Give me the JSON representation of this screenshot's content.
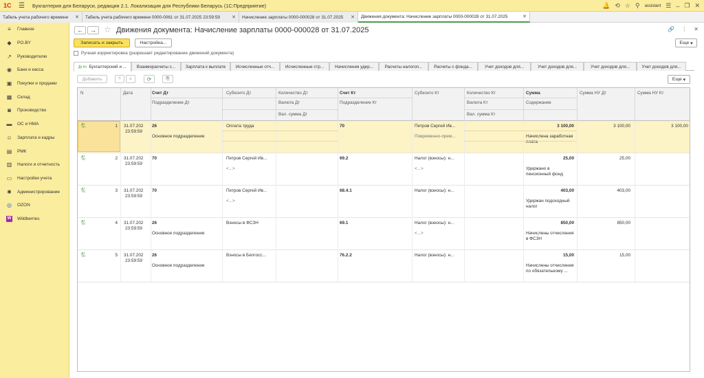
{
  "app": {
    "title": "Бухгалтерия для Беларуси, редакция 2.1. Локализация для Республики Беларусь   (1С:Предприятие)",
    "logo": "1С",
    "user": "assistant"
  },
  "open_tabs": [
    {
      "label": "Табель учета рабочего времени"
    },
    {
      "label": "Табель учета рабочего времени 0000-0061 от 31.07.2025 23:59:59"
    },
    {
      "label": "Начисление зарплаты 0000-000028 от 31.07.2025"
    },
    {
      "label": "Движения документа: Начисление зарплаты 0000-000028 от 31.07.2025"
    }
  ],
  "sidebar": [
    {
      "label": "Главное",
      "icon": "menu-icon"
    },
    {
      "label": "PO.BY",
      "icon": "tag-icon"
    },
    {
      "label": "Руководителю",
      "icon": "trend-icon"
    },
    {
      "label": "Банк и касса",
      "icon": "coin-icon"
    },
    {
      "label": "Покупки и продажи",
      "icon": "cart-icon"
    },
    {
      "label": "Склад",
      "icon": "warehouse-icon"
    },
    {
      "label": "Производство",
      "icon": "factory-icon"
    },
    {
      "label": "ОС и НМА",
      "icon": "truck-icon"
    },
    {
      "label": "Зарплата и кадры",
      "icon": "people-icon"
    },
    {
      "label": "РМК",
      "icon": "register-icon"
    },
    {
      "label": "Налоги и отчетность",
      "icon": "chart-icon"
    },
    {
      "label": "Настройки учета",
      "icon": "doc-icon"
    },
    {
      "label": "Администрирование",
      "icon": "gear-icon"
    },
    {
      "label": "OZON",
      "icon": "ozon-icon"
    },
    {
      "label": "Wildberries",
      "icon": "wb-icon"
    }
  ],
  "doc": {
    "title": "Движения документа: Начисление зарплаты 0000-000028 от 31.07.2025"
  },
  "toolbar": {
    "save_close": "Записать и закрыть",
    "settings": "Настройка...",
    "more": "Еще",
    "add": "Добавить"
  },
  "manual_correction": "Ручная корректировка (разрешает редактирование движений документа)",
  "register_tabs": [
    "Бухгалтерский и ...",
    "Взаиморасчеты с...",
    "Зарплата к выплате",
    "Исчисленные отч...",
    "Исчисленные стр...",
    "Начисления удер...",
    "Расчеты налогоп...",
    "Расчеты с фонда...",
    "Учет доходов для...",
    "Учет доходов для...",
    "Учет доходов для...",
    "Учет доходов для..."
  ],
  "headers": {
    "n": "N",
    "date": "Дата",
    "schet_dt": "Счет Дт",
    "podr_dt": "Подразделение Дт",
    "subkonto_dt": "Субконто Дт",
    "kol_dt": "Количество Дт",
    "valuta_dt": "Валюта Дт",
    "val_sum_dt": "Вал. сумма Дт",
    "schet_kt": "Счет Кт",
    "podr_kt": "Подразделение Кт",
    "subkonto_kt": "Субконто Кт",
    "kol_kt": "Количество Кт",
    "valuta_kt": "Валюта Кт",
    "val_sum_kt": "Вал. сумма Кт",
    "summa": "Сумма",
    "soderzhanie": "Содержание",
    "summa_nu_dt": "Сумма НУ Дт",
    "summa_nu_kt": "Сумма НУ Кт"
  },
  "rows": [
    {
      "n": "1",
      "date": "31.07.202",
      "time": "23:59:59",
      "dt": "26",
      "podr_dt": "Основное подразделение",
      "sub_dt": "Оплата труда",
      "sub_dt2": "",
      "kt": "70",
      "sub_kt": "Петров Сергей Ив...",
      "sub_kt2": "Повременно-прем...",
      "sum": "3 100,00",
      "content": "Начислена заработная плата",
      "nu_dt": "3 100,00",
      "nu_kt": "3 100,00"
    },
    {
      "n": "2",
      "date": "31.07.202",
      "time": "23:59:59",
      "dt": "70",
      "podr_dt": "",
      "sub_dt": "Петров Сергей Ив...",
      "sub_dt2": "<...>",
      "kt": "69.2",
      "sub_kt": "Налог (взносы): н...",
      "sub_kt2": "<...>",
      "sum": "25,00",
      "content": "Удержано в пенсионный фонд",
      "nu_dt": "25,00",
      "nu_kt": ""
    },
    {
      "n": "3",
      "date": "31.07.202",
      "time": "23:59:59",
      "dt": "70",
      "podr_dt": "",
      "sub_dt": "Петров Сергей Ив...",
      "sub_dt2": "<...>",
      "kt": "68.4.1",
      "sub_kt": "Налог (взносы): н...",
      "sub_kt2": "",
      "sum": "403,00",
      "content": "Удержан подоходный налог",
      "nu_dt": "403,00",
      "nu_kt": ""
    },
    {
      "n": "4",
      "date": "31.07.202",
      "time": "23:59:59",
      "dt": "26",
      "podr_dt": "Основное подразделение",
      "sub_dt": "Взносы в ФСЗН",
      "sub_dt2": "",
      "kt": "69.1",
      "sub_kt": "Налог (взносы): н...",
      "sub_kt2": "<...>",
      "sum": "850,00",
      "content": "Начислены отчисления в ФСЗН",
      "nu_dt": "850,00",
      "nu_kt": ""
    },
    {
      "n": "5",
      "date": "31.07.202",
      "time": "23:59:59",
      "dt": "26",
      "podr_dt": "Основное подразделение",
      "sub_dt": "Взносы в Белгосс...",
      "sub_dt2": "",
      "kt": "76.2.2",
      "sub_kt": "Налог (взносы): н...",
      "sub_kt2": "",
      "sum": "15,00",
      "content": "Начислены отчисления по обязательному ...",
      "nu_dt": "15,00",
      "nu_kt": ""
    }
  ],
  "chart_data": {
    "type": "table",
    "columns": [
      "N",
      "Дата",
      "Счет Дт",
      "Субконто Дт",
      "Счет Кт",
      "Субконто Кт",
      "Сумма",
      "Содержание",
      "Сумма НУ Дт",
      "Сумма НУ Кт"
    ],
    "rows": [
      [
        "1",
        "31.07.202 23:59:59",
        "26",
        "Оплата труда",
        "70",
        "Петров Сергей Ив...",
        "3 100,00",
        "Начислена заработная плата",
        "3 100,00",
        "3 100,00"
      ],
      [
        "2",
        "31.07.202 23:59:59",
        "70",
        "Петров Сергей Ив...",
        "69.2",
        "Налог (взносы): н...",
        "25,00",
        "Удержано в пенсионный фонд",
        "25,00",
        ""
      ],
      [
        "3",
        "31.07.202 23:59:59",
        "70",
        "Петров Сергей Ив...",
        "68.4.1",
        "Налог (взносы): н...",
        "403,00",
        "Удержан подоходный налог",
        "403,00",
        ""
      ],
      [
        "4",
        "31.07.202 23:59:59",
        "26",
        "Взносы в ФСЗН",
        "69.1",
        "Налог (взносы): н...",
        "850,00",
        "Начислены отчисления в ФСЗН",
        "850,00",
        ""
      ],
      [
        "5",
        "31.07.202 23:59:59",
        "26",
        "Взносы в Белгосс...",
        "76.2.2",
        "Налог (взносы): н...",
        "15,00",
        "Начислены отчисления по обязательному ...",
        "15,00",
        ""
      ]
    ]
  }
}
